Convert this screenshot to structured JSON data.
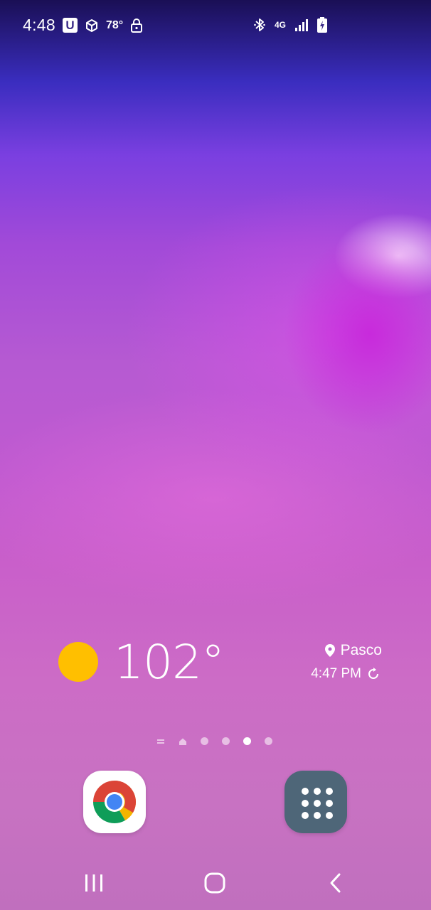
{
  "status_bar": {
    "time": "4:48",
    "temperature": "78°",
    "network": "4G",
    "icons": [
      "u-app-icon",
      "box-icon",
      "lock-icon",
      "bluetooth-icon",
      "signal-icon",
      "battery-charging-icon"
    ]
  },
  "weather_widget": {
    "temperature": "102°",
    "condition_icon": "sun-icon",
    "location": "Pasco",
    "updated_time": "4:47 PM"
  },
  "page_indicators": {
    "count": 6,
    "active_index": 4,
    "icons": [
      "menu-lines-icon",
      "home-icon",
      "dot",
      "dot",
      "dot",
      "dot"
    ]
  },
  "dock": {
    "apps": [
      {
        "name": "Chrome",
        "icon": "chrome-icon"
      },
      {
        "name": "Apps",
        "icon": "app-drawer-icon"
      }
    ]
  },
  "navigation_bar": {
    "buttons": [
      "recents-icon",
      "home-icon",
      "back-icon"
    ]
  },
  "colors": {
    "sun": "#ffbf00",
    "apps_tile": "#4e6678",
    "chrome_red": "#db4437",
    "chrome_green": "#0f9d58",
    "chrome_yellow": "#f4b400",
    "chrome_blue": "#4285f4"
  }
}
